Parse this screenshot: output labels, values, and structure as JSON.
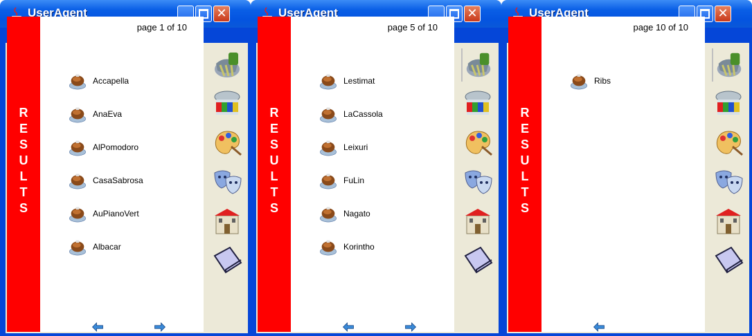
{
  "windows": [
    {
      "title": "UserAgent",
      "page_label": "page  1  of  10",
      "sidebar_label": [
        "R",
        "E",
        "S",
        "U",
        "L",
        "T",
        "S"
      ],
      "results": [
        "Accapella",
        "AnaEva",
        "AlPomodoro",
        "CasaSabrosa",
        "AuPianoVert",
        "Albacar"
      ],
      "nav": {
        "prev": true,
        "next": true
      }
    },
    {
      "title": "UserAgent",
      "page_label": "page  5  of  10",
      "sidebar_label": [
        "R",
        "E",
        "S",
        "U",
        "L",
        "T",
        "S"
      ],
      "results": [
        "Lestimat",
        "LaCassola",
        "Leixuri",
        "FuLin",
        "Nagato",
        "Korintho"
      ],
      "nav": {
        "prev": true,
        "next": true
      }
    },
    {
      "title": "UserAgent",
      "page_label": "page  10  of  10",
      "sidebar_label": [
        "R",
        "E",
        "S",
        "U",
        "L",
        "T",
        "S"
      ],
      "results": [
        "Ribs"
      ],
      "nav": {
        "prev": true,
        "next": false
      }
    }
  ],
  "categories": [
    "restaurants-icon",
    "cinema-icon",
    "art-palette-icon",
    "theatre-masks-icon",
    "castle-icon",
    "book-icon"
  ],
  "colors": {
    "titlebar": "#0454e0",
    "results_bar": "#ff0000",
    "panel": "#ece9d8"
  }
}
